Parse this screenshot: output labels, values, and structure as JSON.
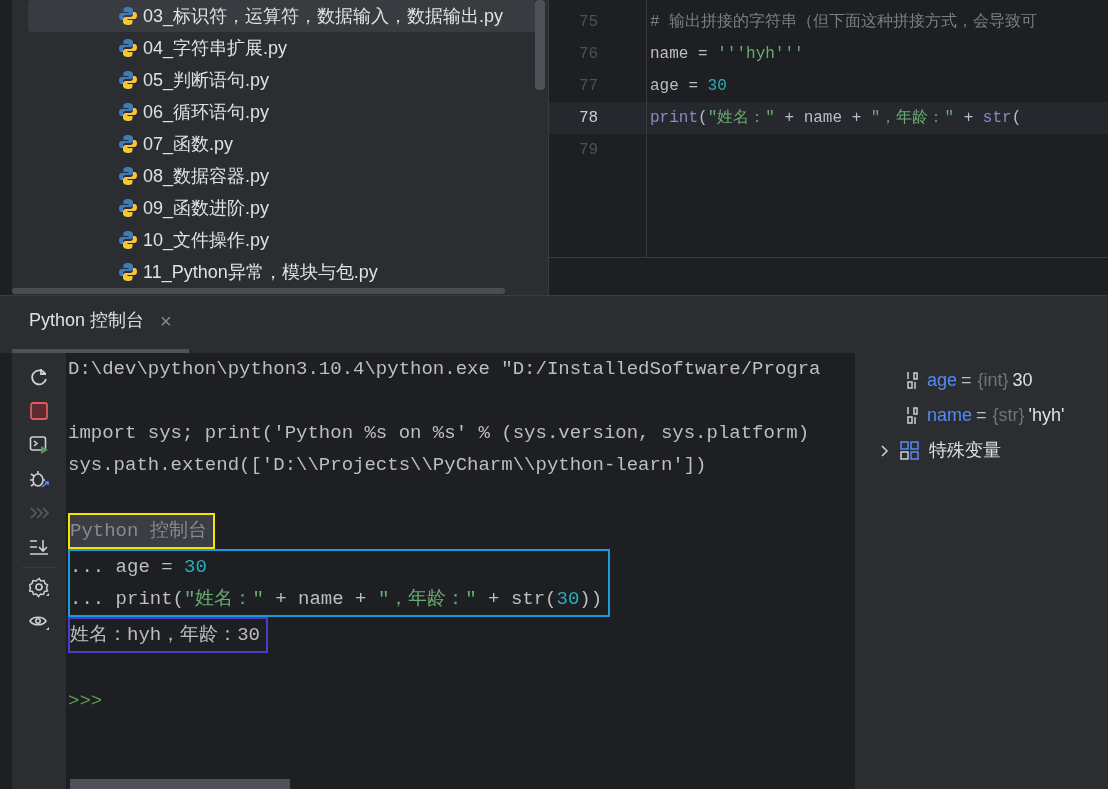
{
  "project_tree": {
    "items": [
      {
        "label": "03_标识符，运算符，数据输入，数据输出.py",
        "selected": true
      },
      {
        "label": "04_字符串扩展.py",
        "selected": false
      },
      {
        "label": "05_判断语句.py",
        "selected": false
      },
      {
        "label": "06_循环语句.py",
        "selected": false
      },
      {
        "label": "07_函数.py",
        "selected": false
      },
      {
        "label": "08_数据容器.py",
        "selected": false
      },
      {
        "label": "09_函数进阶.py",
        "selected": false
      },
      {
        "label": "10_文件操作.py",
        "selected": false
      },
      {
        "label": "11_Python异常，模块与包.py",
        "selected": false
      }
    ]
  },
  "editor": {
    "lines": [
      {
        "number": "75",
        "current": false,
        "segments": [
          {
            "kind": "comment",
            "text": "# 输出拼接的字符串（但下面这种拼接方式，会导致可"
          }
        ]
      },
      {
        "number": "76",
        "current": false,
        "segments": [
          {
            "kind": "plain",
            "text": "name = "
          },
          {
            "kind": "string",
            "text": "'''hyh'''"
          }
        ]
      },
      {
        "number": "77",
        "current": false,
        "segments": [
          {
            "kind": "plain",
            "text": "age = "
          },
          {
            "kind": "number",
            "text": "30"
          }
        ]
      },
      {
        "number": "78",
        "current": true,
        "segments": [
          {
            "kind": "builtin",
            "text": "print"
          },
          {
            "kind": "plain",
            "text": "("
          },
          {
            "kind": "string",
            "text": "\"姓名：\""
          },
          {
            "kind": "plain",
            "text": " + name + "
          },
          {
            "kind": "string",
            "text": "\"，年龄：\""
          },
          {
            "kind": "plain",
            "text": " + "
          },
          {
            "kind": "builtin",
            "text": "str"
          },
          {
            "kind": "plain",
            "text": "("
          }
        ]
      },
      {
        "number": "79",
        "current": false
      }
    ]
  },
  "console": {
    "tab": {
      "label": "Python 控制台",
      "close": "×",
      "selected": true
    },
    "blocks": [
      {
        "lines": [
          {
            "kind": "code",
            "segments": [
              {
                "kind": "plain",
                "text": "D:\\dev\\python\\python3.10.4\\python.exe \"D:/InstalledSoftware/Progra"
              }
            ]
          },
          {
            "kind": "blank"
          },
          {
            "kind": "code",
            "segments": [
              {
                "kind": "plain",
                "text": "import sys; print('Python %s on %s' % (sys.version, sys.platform)"
              }
            ]
          },
          {
            "kind": "code",
            "segments": [
              {
                "kind": "plain",
                "text": "sys.path.extend(['D:\\\\Projects\\\\PyCharm\\\\python-learn'])"
              }
            ]
          },
          {
            "kind": "blank"
          }
        ]
      },
      {
        "color": "#f5e400",
        "lines": [
          {
            "kind": "code",
            "segments": [
              {
                "kind": "banner",
                "text": "Python 控制台"
              }
            ]
          }
        ]
      },
      {
        "color": "#1d9bd8",
        "lines": [
          {
            "kind": "code",
            "segments": [
              {
                "kind": "plain",
                "text": "... age = "
              },
              {
                "kind": "number",
                "text": "30"
              }
            ]
          },
          {
            "kind": "code",
            "segments": [
              {
                "kind": "plain",
                "text": "... print("
              },
              {
                "kind": "string",
                "text": "\"姓名：\""
              },
              {
                "kind": "plain",
                "text": " + name + "
              },
              {
                "kind": "string",
                "text": "\"，年龄：\""
              },
              {
                "kind": "plain",
                "text": " + str("
              },
              {
                "kind": "number",
                "text": "30"
              },
              {
                "kind": "plain",
                "text": "))"
              }
            ]
          }
        ]
      },
      {
        "color": "#4a3fc4",
        "lines": [
          {
            "kind": "code",
            "segments": [
              {
                "kind": "plain",
                "text": "姓名：hyh，年龄：30"
              }
            ]
          }
        ]
      },
      {
        "lines": [
          {
            "kind": "blank"
          },
          {
            "kind": "code",
            "segments": [
              {
                "kind": "prompt",
                "text": ">>>"
              }
            ]
          }
        ]
      }
    ]
  },
  "variables": {
    "items": [
      {
        "kind": "var",
        "name": "age",
        "operator": "=",
        "type": "{int}",
        "value": "30"
      },
      {
        "kind": "var",
        "name": "name",
        "operator": "=",
        "type": "{str}",
        "value": "'hyh'"
      },
      {
        "kind": "group",
        "label": "特殊变量",
        "expanded": false
      }
    ]
  }
}
